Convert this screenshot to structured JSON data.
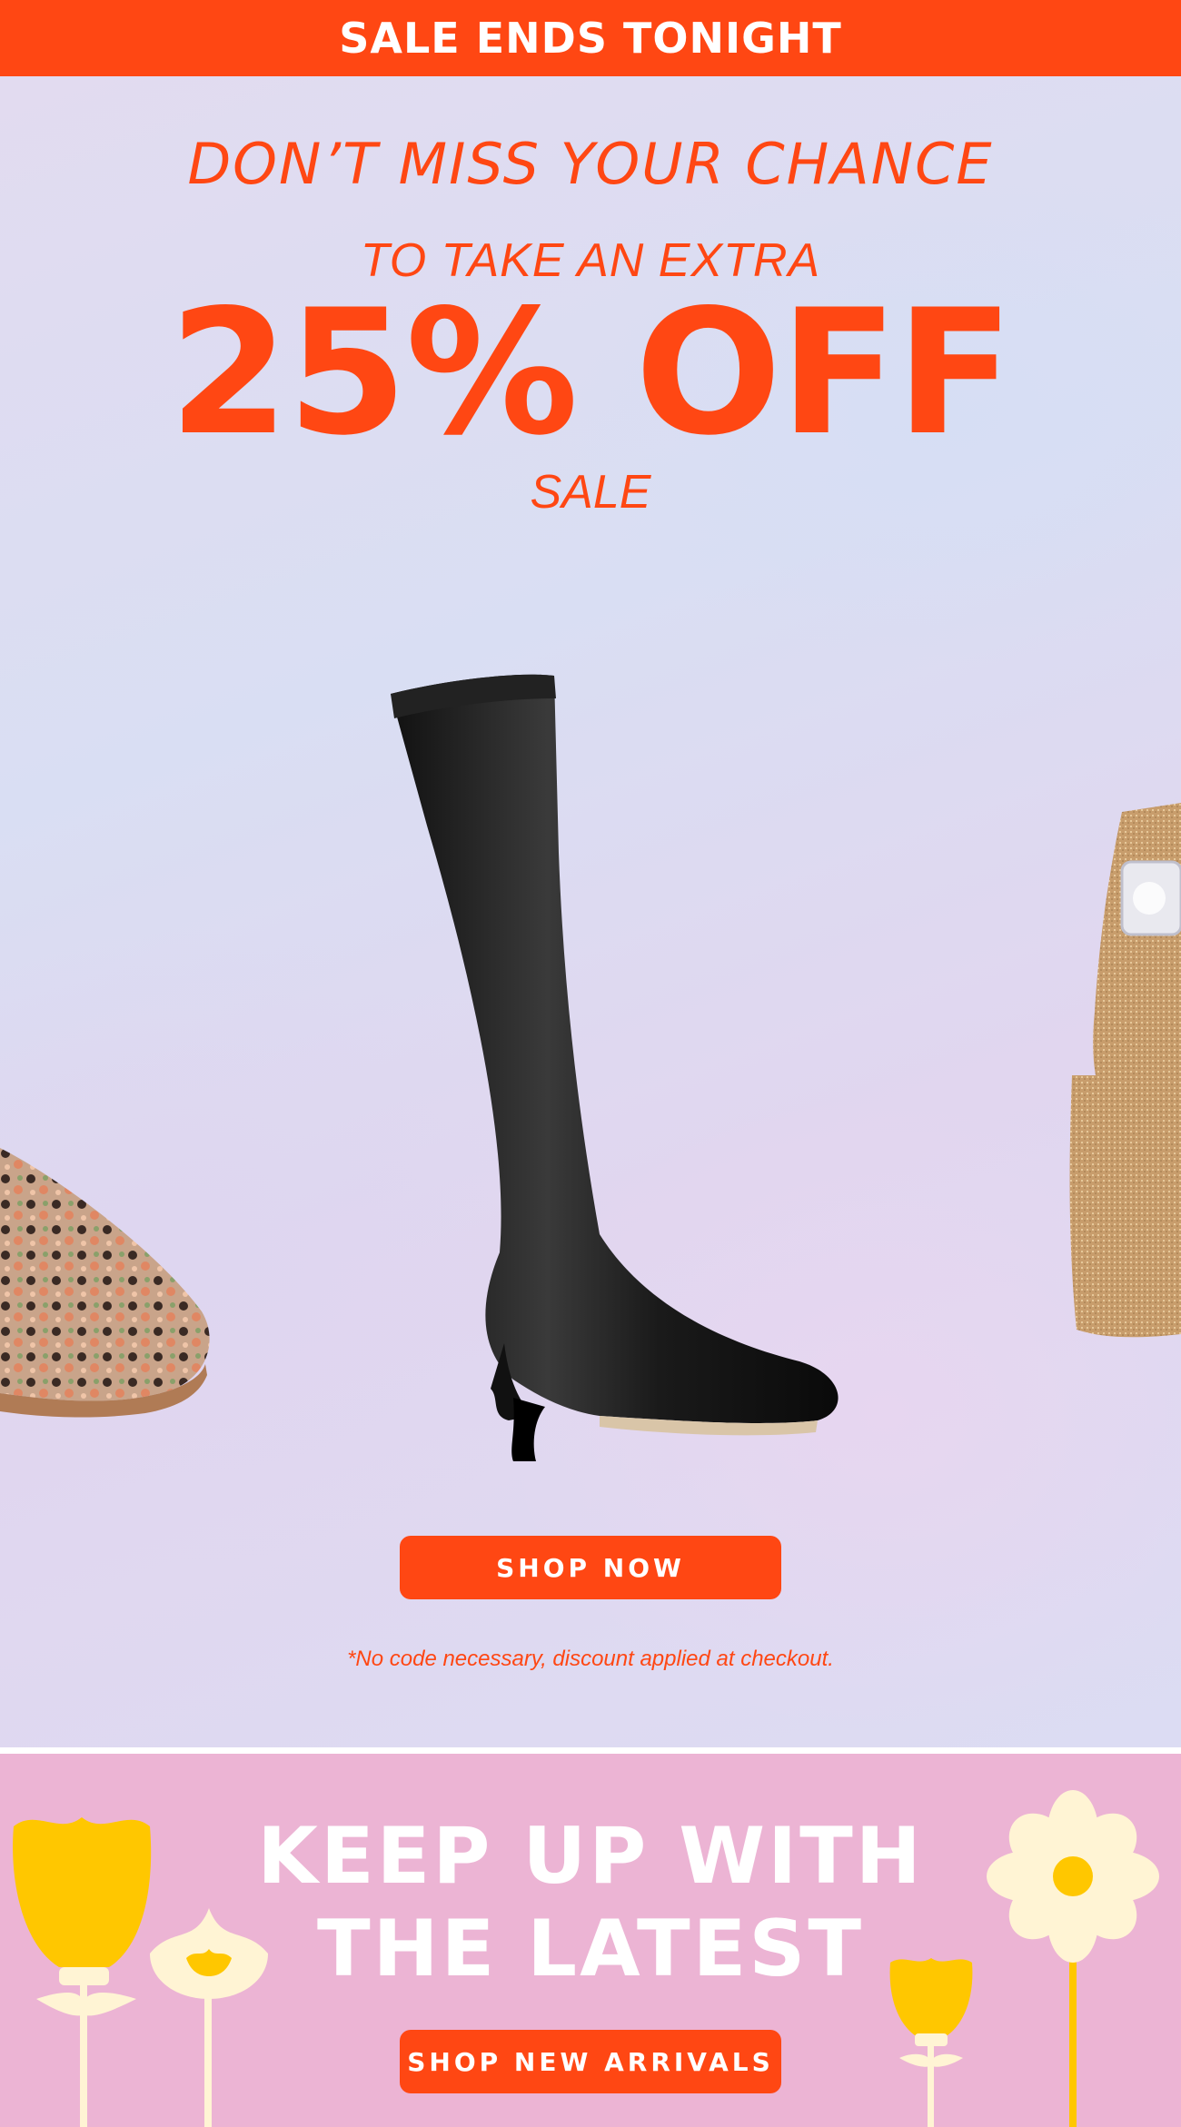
{
  "banner": {
    "text": "SALE ENDS TONIGHT"
  },
  "hero": {
    "headline": "DON’T MISS YOUR CHANCE",
    "subhead": "TO TAKE AN EXTRA",
    "offer": "25% OFF",
    "category": "SALE",
    "cta_label": "SHOP NOW",
    "disclaimer": "*No code necessary, discount applied at checkout."
  },
  "latest": {
    "line1": "KEEP UP WITH",
    "line2": "THE LATEST",
    "cta_label": "SHOP NEW ARRIVALS"
  },
  "colors": {
    "accent": "#ff4713",
    "hero_bg": "#dcdcf3",
    "bottom_bg": "#ecb4d4",
    "flower_yellow": "#ffc700",
    "flower_cream": "#fff4d4"
  }
}
